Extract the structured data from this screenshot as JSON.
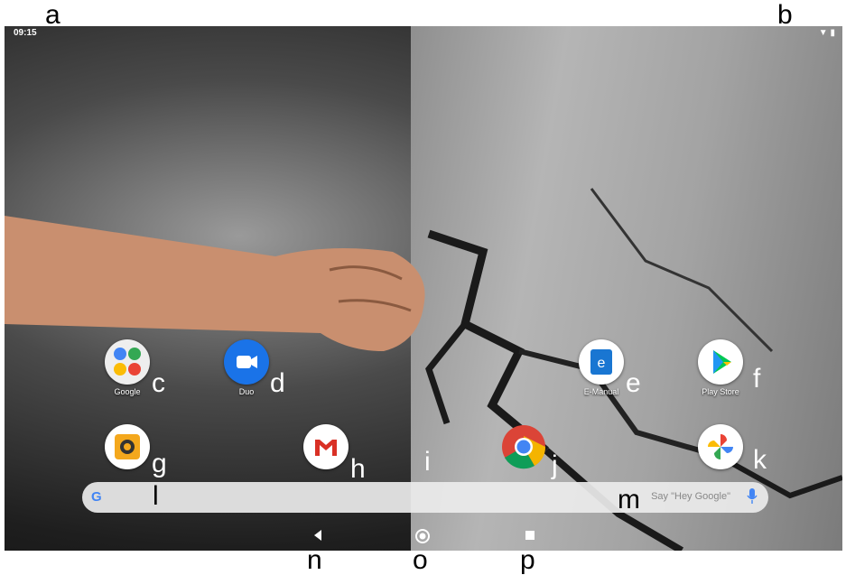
{
  "callouts": {
    "a": "a",
    "b": "b",
    "c": "c",
    "d": "d",
    "e": "e",
    "f": "f",
    "g": "g",
    "h": "h",
    "i": "i",
    "j": "j",
    "k": "k",
    "l": "l",
    "m": "m",
    "n": "n",
    "o": "o",
    "p": "p"
  },
  "status_bar": {
    "time": "09:15"
  },
  "apps": {
    "google": {
      "label": "Google"
    },
    "duo": {
      "label": "Duo"
    },
    "emanual": {
      "label": "E-Manual"
    },
    "playstore": {
      "label": "Play Store"
    }
  },
  "search": {
    "hint": "Say \"Hey Google\""
  },
  "colors": {
    "duo_blue": "#1a73e8",
    "gmail_red": "#d93025",
    "chrome_red": "#db4437",
    "chrome_yellow": "#f4b400",
    "chrome_green": "#0f9d58",
    "chrome_blue": "#4285f4",
    "emanual_blue": "#1976d2",
    "camera_orange": "#f4a81d"
  }
}
